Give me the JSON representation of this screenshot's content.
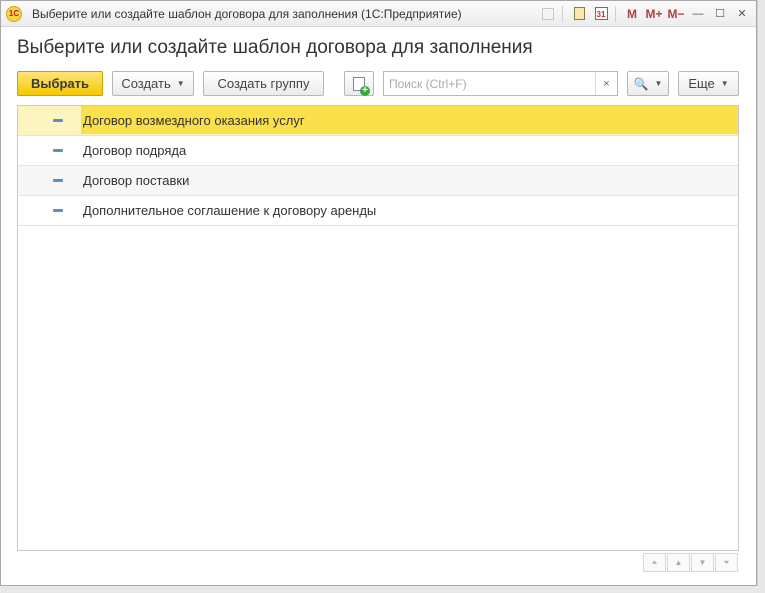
{
  "window": {
    "logo_text": "1С",
    "title": "Выберите или создайте шаблон договора для заполнения  (1С:Предприятие)",
    "icons": [
      "home-icon",
      "calculator-icon",
      "calendar-icon",
      "memory-m-icon",
      "memory-plus-icon",
      "memory-minus-icon",
      "minimize-icon",
      "maximize-icon",
      "close-icon"
    ],
    "calendar_day": "31",
    "mem_m": "M",
    "mem_plus": "M+",
    "mem_minus": "M−",
    "minimize": "—",
    "maximize": "☐",
    "close": "✕"
  },
  "form": {
    "heading": "Выберите или создайте шаблон договора для заполнения"
  },
  "toolbar": {
    "select_label": "Выбрать",
    "create_label": "Создать",
    "create_group_label": "Создать группу",
    "search_placeholder": "Поиск (Ctrl+F)",
    "search_clear": "×",
    "search_icon": "🔍",
    "more_label": "Еще",
    "caret": "▼"
  },
  "list": {
    "rows": [
      {
        "label": "Договор возмездного оказания услуг",
        "selected": true
      },
      {
        "label": "Договор подряда",
        "selected": false
      },
      {
        "label": "Договор поставки",
        "selected": false
      },
      {
        "label": "Дополнительное соглашение к договору аренды",
        "selected": false
      }
    ]
  },
  "nav": {
    "first": "⏶",
    "prev": "▲",
    "next": "▼",
    "last": "⏷"
  },
  "colors": {
    "accent": "#f5c800",
    "selection": "#fbe04c",
    "marker": "#5b8fc7"
  }
}
